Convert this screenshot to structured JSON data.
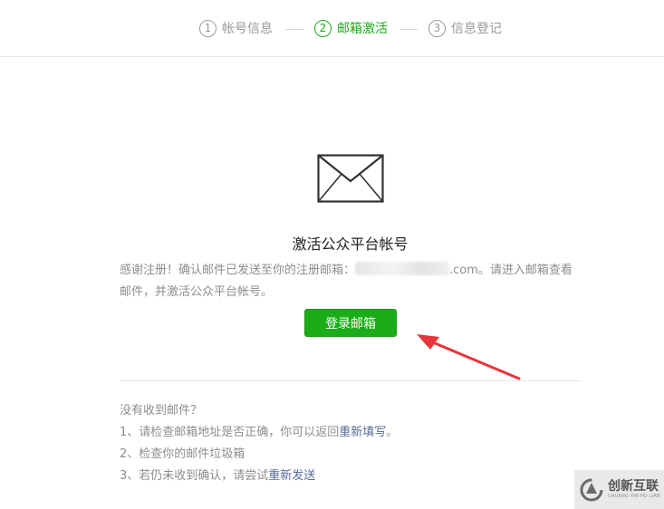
{
  "steps": [
    {
      "num": "1",
      "label": "帐号信息",
      "active": false
    },
    {
      "num": "2",
      "label": "邮箱激活",
      "active": true
    },
    {
      "num": "3",
      "label": "信息登记",
      "active": false
    }
  ],
  "icons": {
    "envelope": "envelope-icon",
    "arrow": "red-arrow-annotation",
    "watermark_logo": "chuangxin-logo"
  },
  "main": {
    "title": "激活公众平台帐号",
    "desc_prefix": "感谢注册！确认邮件已发送至你的注册邮箱：",
    "email_suffix": ".com",
    "desc_suffix": "。请进入邮箱查看邮件，并激活公众平台帐号。",
    "login_button": "登录邮箱"
  },
  "help": {
    "heading": "没有收到邮件？",
    "item1_prefix": "1、请检查邮箱地址是否正确，你可以返回",
    "item1_link": "重新填写",
    "item1_suffix": "。",
    "item2": "2、检查你的邮件垃圾箱",
    "item3_prefix": "3、若仍未收到确认，请尝试",
    "item3_link": "重新发送"
  },
  "watermark": {
    "main": "创新互联",
    "sub": "CHUANG XIN HU LIAN"
  },
  "colors": {
    "accent": "#1aad19",
    "link": "#576b95",
    "muted": "#8d8d8d",
    "arrow": "#e8353a"
  }
}
